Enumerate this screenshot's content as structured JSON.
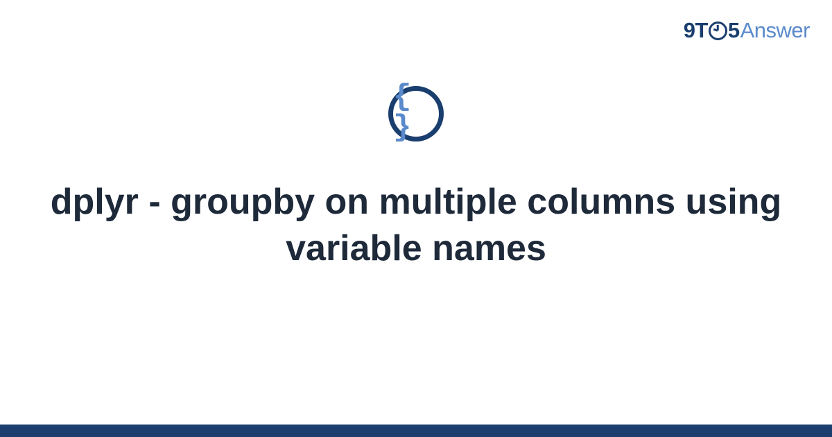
{
  "brand": {
    "part1": "9T",
    "part2": "5",
    "part3": "Answer"
  },
  "icon": {
    "glyph": "{ }",
    "name": "code-braces-icon"
  },
  "title": "dplyr - groupby on multiple columns using variable names",
  "colors": {
    "primary": "#1a3e6e",
    "accent": "#5a8acb",
    "text": "#1e2a3a"
  }
}
